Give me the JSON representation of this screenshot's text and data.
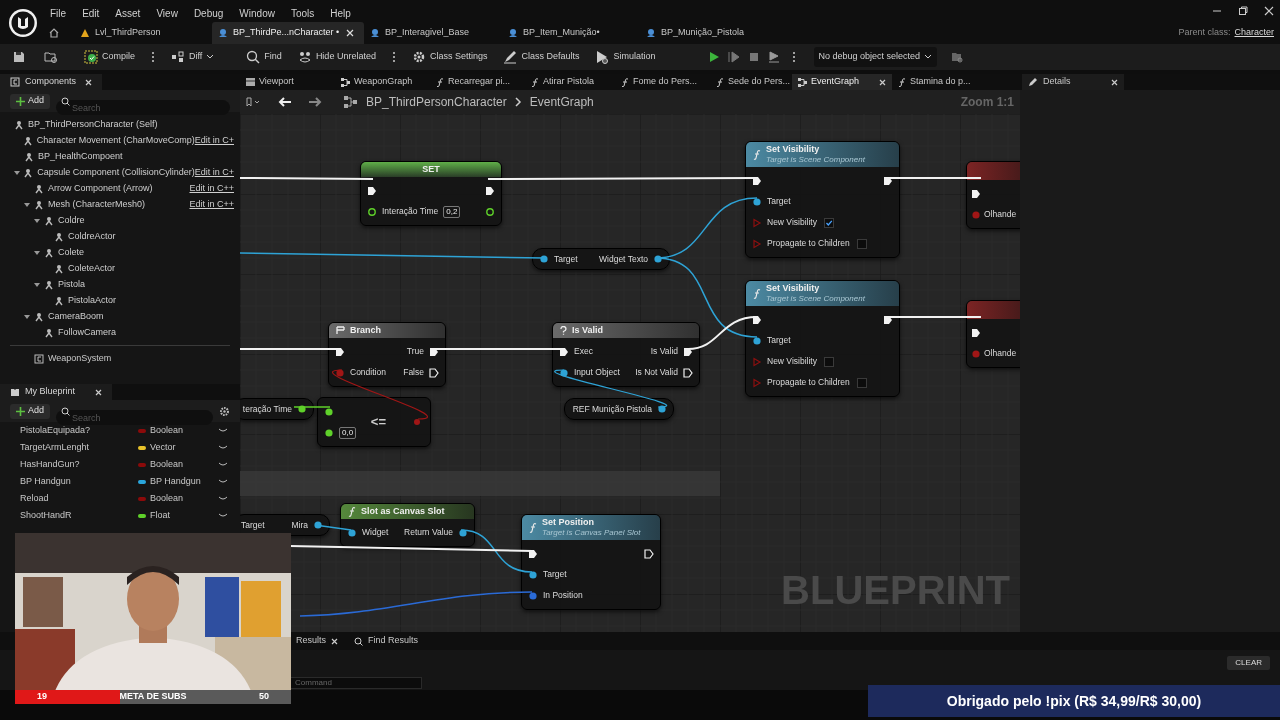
{
  "menu": [
    "File",
    "Edit",
    "Asset",
    "View",
    "Debug",
    "Window",
    "Tools",
    "Help"
  ],
  "tabs": [
    {
      "label": "Lvl_ThirdPerson",
      "selected": false,
      "kind": "level"
    },
    {
      "label": "BP_ThirdPe...nCharacter •",
      "selected": true,
      "kind": "blueprint"
    },
    {
      "label": "BP_Interagivel_Base",
      "selected": false,
      "kind": "blueprint"
    },
    {
      "label": "BP_Item_Munição•",
      "selected": false,
      "kind": "blueprint"
    },
    {
      "label": "BP_Munição_Pistola",
      "selected": false,
      "kind": "blueprint"
    }
  ],
  "parent_class": {
    "label": "Parent class:",
    "value": "Character"
  },
  "toolbar": {
    "buttons": [
      "Compile",
      "Diff",
      "Find",
      "Hide Unrelated",
      "Class Settings",
      "Class Defaults",
      "Simulation"
    ],
    "debug_object": "No debug object selected"
  },
  "components": {
    "title": "Components",
    "add": "Add",
    "placeholder": "Search",
    "tree": [
      {
        "label": "BP_ThirdPersonCharacter (Self)",
        "children": [
          {
            "label": "Character Movement (CharMoveComp)",
            "link": "Edit in C+"
          },
          {
            "label": "BP_HealthCompoent"
          },
          {
            "label": "Capsule Component (CollisionCylinder)",
            "link": "Edit in C+",
            "expanded": true,
            "children": [
              {
                "label": "Arrow Component (Arrow)",
                "link": "Edit in C++"
              },
              {
                "label": "Mesh (CharacterMesh0)",
                "link": "Edit in C++",
                "expanded": true,
                "children": [
                  {
                    "label": "Coldre",
                    "expanded": true,
                    "children": [
                      {
                        "label": "ColdreActor"
                      }
                    ]
                  },
                  {
                    "label": "Colete",
                    "expanded": true,
                    "children": [
                      {
                        "label": "ColeteActor"
                      }
                    ]
                  },
                  {
                    "label": "Pistola",
                    "expanded": true,
                    "children": [
                      {
                        "label": "PistolaActor"
                      }
                    ]
                  }
                ]
              },
              {
                "label": "CameraBoom",
                "expanded": true,
                "children": [
                  {
                    "label": "FollowCamera"
                  }
                ]
              }
            ]
          }
        ]
      }
    ],
    "other": [
      {
        "label": "WeaponSystem"
      }
    ]
  },
  "my_blueprint": {
    "title": "My Blueprint",
    "add": "Add",
    "placeholder": "Search",
    "variables": [
      {
        "name": "PistolaEquipada?",
        "type": "Boolean",
        "color": "#8b0a0a"
      },
      {
        "name": "TargetArmLenght",
        "type": "Vector",
        "color": "#e8c22a"
      },
      {
        "name": "HasHandGun?",
        "type": "Boolean",
        "color": "#8b0a0a"
      },
      {
        "name": "BP Handgun",
        "type": "BP Handgun",
        "color": "#2aa6dc"
      },
      {
        "name": "Reload",
        "type": "Boolean",
        "color": "#8b0a0a"
      },
      {
        "name": "ShootHandR",
        "type": "Float",
        "color": "#5fd12a"
      }
    ]
  },
  "graph_tabs": [
    {
      "label": "Viewport",
      "selected": false
    },
    {
      "label": "WeaponGraph",
      "selected": false
    },
    {
      "label": "Recarregar pi...",
      "selected": false
    },
    {
      "label": "Atirar Pistola",
      "selected": false
    },
    {
      "label": "Fome do Pers...",
      "selected": false
    },
    {
      "label": "Sede do Pers...",
      "selected": false
    },
    {
      "label": "EventGraph",
      "selected": true
    },
    {
      "label": "Stamina do p...",
      "selected": false
    }
  ],
  "details": {
    "title": "Details"
  },
  "breadcrumb": [
    "BP_ThirdPersonCharacter",
    "EventGraph"
  ],
  "zoom": "Zoom 1:1",
  "graph": {
    "watermark": "BLUEPRINT",
    "nodes": [
      {
        "kind": "set",
        "title": "SET",
        "rows": [
          {
            "left_pin": {
              "kind": "exec",
              "filled": true
            },
            "right_pin": {
              "kind": "exec",
              "filled": true
            }
          },
          {
            "left_pin": {
              "kind": "float",
              "filled": false
            },
            "left": "Interação Time",
            "value": "0,2",
            "right_pin": {
              "kind": "float",
              "filled": false
            }
          }
        ]
      },
      {
        "kind": "function",
        "title": "Set Visibility",
        "subtitle": "Target is Scene Component",
        "rows": [
          {
            "left_pin": {
              "kind": "exec",
              "filled": true
            },
            "right_pin": {
              "kind": "exec",
              "filled": true
            }
          },
          {
            "left_pin": {
              "kind": "object",
              "filled": true
            },
            "left": "Target"
          },
          {
            "left_pin": {
              "kind": "bool",
              "filled": false
            },
            "left": "New Visibility",
            "checked": true
          },
          {
            "left_pin": {
              "kind": "bool",
              "filled": false
            },
            "left": "Propagate to Children",
            "checked": false
          }
        ]
      },
      {
        "kind": "function",
        "title": "Set Visibility",
        "subtitle": "Target is Scene Component",
        "rows": [
          {
            "left_pin": {
              "kind": "exec",
              "filled": true
            },
            "right_pin": {
              "kind": "exec",
              "filled": true
            }
          },
          {
            "left_pin": {
              "kind": "object",
              "filled": true
            },
            "left": "Target"
          },
          {
            "left_pin": {
              "kind": "bool",
              "filled": false
            },
            "left": "New Visibility",
            "checked": false
          },
          {
            "left_pin": {
              "kind": "bool",
              "filled": false
            },
            "left": "Propagate to Children",
            "checked": false
          }
        ]
      },
      {
        "kind": "getter",
        "rows": [
          {
            "left_pin": {
              "kind": "object",
              "filled": true
            },
            "left": "Target",
            "right": "Widget Texto",
            "right_pin": {
              "kind": "object",
              "filled": true
            }
          }
        ]
      },
      {
        "kind": "flow",
        "title": "Branch",
        "rows": [
          {
            "left_pin": {
              "kind": "exec",
              "filled": true
            },
            "right": "True",
            "right_pin": {
              "kind": "exec",
              "filled": true
            }
          },
          {
            "left_pin": {
              "kind": "bool",
              "filled": true
            },
            "left": "Condition",
            "right": "False",
            "right_pin": {
              "kind": "exec",
              "filled": false
            }
          }
        ]
      },
      {
        "kind": "flow",
        "title": "Is Valid",
        "rows": [
          {
            "left_pin": {
              "kind": "exec",
              "filled": true
            },
            "left": "Exec",
            "right": "Is Valid",
            "right_pin": {
              "kind": "exec",
              "filled": true
            }
          },
          {
            "left_pin": {
              "kind": "object",
              "filled": true
            },
            "left": "Input Object",
            "right": "Is Not Valid",
            "right_pin": {
              "kind": "exec",
              "filled": false
            }
          }
        ]
      },
      {
        "kind": "compare",
        "symbol": "<=",
        "rows": [
          {
            "left_pin": {
              "kind": "float",
              "filled": true
            }
          },
          {
            "left_pin": {
              "kind": "float",
              "filled": true
            },
            "value": "0,0"
          }
        ]
      },
      {
        "kind": "getter",
        "rows": [
          {
            "right": "teração Time",
            "right_pin": {
              "kind": "float",
              "filled": true
            }
          }
        ]
      },
      {
        "kind": "getter",
        "rows": [
          {
            "right": "REF Munição Pistola",
            "right_pin": {
              "kind": "object",
              "filled": true
            }
          }
        ]
      },
      {
        "kind": "event",
        "rows": [
          {
            "left_pin": {
              "kind": "exec",
              "filled": true
            }
          },
          {
            "left_pin": {
              "kind": "bool",
              "filled": true
            },
            "left": "Olhande"
          }
        ]
      },
      {
        "kind": "event",
        "rows": [
          {
            "left_pin": {
              "kind": "exec",
              "filled": true
            }
          },
          {
            "left_pin": {
              "kind": "bool",
              "filled": true
            },
            "left": "Olhande"
          }
        ]
      },
      {
        "kind": "getter",
        "rows": [
          {
            "left": "Target",
            "right": "Mira",
            "right_pin": {
              "kind": "object",
              "filled": true
            }
          }
        ]
      },
      {
        "kind": "pure",
        "title": "Slot as Canvas Slot",
        "rows": [
          {
            "left_pin": {
              "kind": "object",
              "filled": true
            },
            "left": "Widget",
            "right": "Return Value",
            "right_pin": {
              "kind": "object",
              "filled": true
            }
          }
        ]
      },
      {
        "kind": "function",
        "title": "Set Position",
        "subtitle": "Target is Canvas Panel Slot",
        "rows": [
          {
            "left_pin": {
              "kind": "exec",
              "filled": true
            },
            "right_pin": {
              "kind": "exec",
              "filled": false
            }
          },
          {
            "left_pin": {
              "kind": "object",
              "filled": true
            },
            "left": "Target"
          },
          {
            "left_pin": {
              "kind": "vector",
              "filled": true
            },
            "left": "In Position"
          }
        ]
      }
    ]
  },
  "bottom_tabs": [
    {
      "label": "Results",
      "closable": true
    },
    {
      "label": "Find Results",
      "closable": false
    }
  ],
  "clear": "CLEAR",
  "command": {
    "placeholder": "Command"
  },
  "stream": {
    "goal": {
      "current": "19",
      "label": "META DE SUBS",
      "target": "50",
      "level": 0.38
    },
    "donation": "Obrigado pelo !pix (R$ 34,99/R$ 30,00)"
  }
}
